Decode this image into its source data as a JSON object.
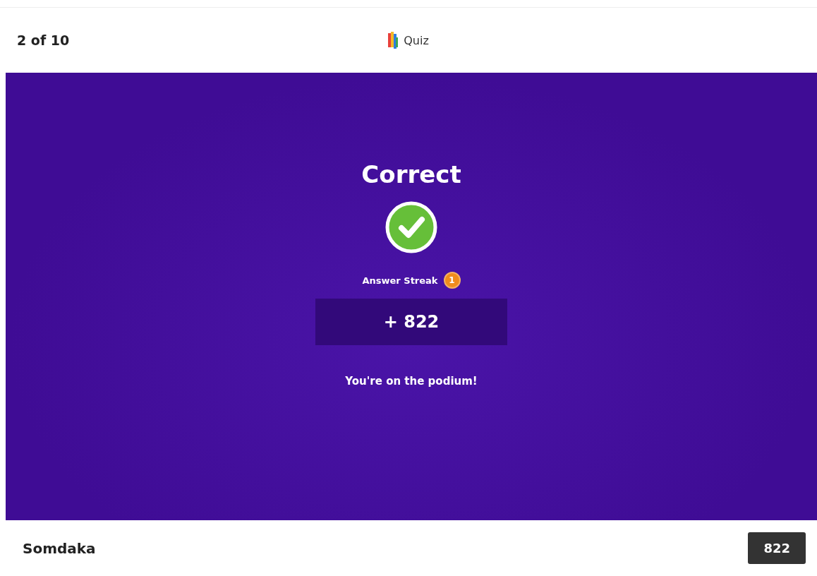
{
  "header": {
    "progress": "2 of 10",
    "title": "Quiz"
  },
  "result": {
    "heading": "Correct",
    "streak_label": "Answer Streak",
    "streak_count": "1",
    "points": "+ 822",
    "message": "You're on the podium!"
  },
  "footer": {
    "player": "Somdaka",
    "score": "822"
  }
}
